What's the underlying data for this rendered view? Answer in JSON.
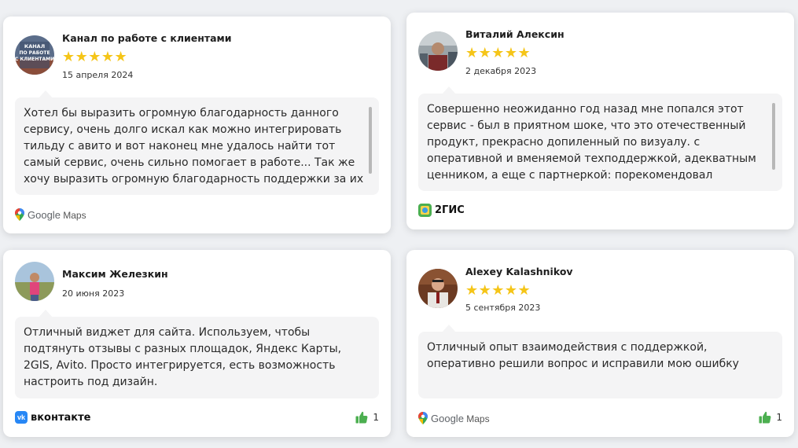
{
  "reviews": [
    {
      "author": "Канал по работе с клиентами",
      "date": "15 апреля 2024",
      "rating": 5,
      "stars": "★★★★★",
      "text": "Хотел бы выразить огромную благодарность данного сервису, очень долго искал как можно интегрировать тильду с авито и вот наконец мне удалось найти тот самый сервис, очень сильно помогает в работе... Так же хочу выразить огромную благодарность поддержки за их быстрые…",
      "source": "Google Maps",
      "source_brand": "Google",
      "source_product": "Maps"
    },
    {
      "author": "Виталий Алексин",
      "date": "2 декабря 2023",
      "rating": 5,
      "stars": "★★★★★",
      "text": "Совершенно неожиданно год назад мне попался этот сервис - был в приятном шоке, что это отечественный продукт, прекрасно допиленный по визуалу. с оперативной и вменяемой техподдержкой, адекватным ценником, а еще с партнеркой: порекомендовал знакомым и за год накопила…",
      "source": "2ГИС"
    },
    {
      "author": "Максим Железкин",
      "date": "20 июня 2023",
      "text": "Отличный виджет для сайта. Используем, чтобы подтянуть отзывы с разных площадок, Яндекс Карты, 2GIS, Avito. Просто интегрируется, есть возможность настроить под дизайн.",
      "source": "вконтакте",
      "likes": "1"
    },
    {
      "author": "Alexey Kalashnikov",
      "date": "5 сентября 2023",
      "rating": 5,
      "stars": "★★★★★",
      "text": "Отличный опыт взаимодействия с поддержкой, оперативно решили вопрос и исправили мою ошибку",
      "source": "Google Maps",
      "source_brand": "Google",
      "source_product": "Maps",
      "likes": "1"
    }
  ],
  "avatar_texts": {
    "r1": "КАНАЛ ПО РАБОТЕ С КЛИЕНТАМИ"
  },
  "colors": {
    "star": "#f5c518",
    "like": "#4caf50",
    "vk": "#2787f5",
    "background": "#eef0f3"
  },
  "icons": {
    "rating": "star-icon",
    "like": "thumbs-up-icon",
    "google_maps": "google-maps-pin-icon",
    "gis": "2gis-logo-icon",
    "vk": "vk-logo-icon"
  }
}
